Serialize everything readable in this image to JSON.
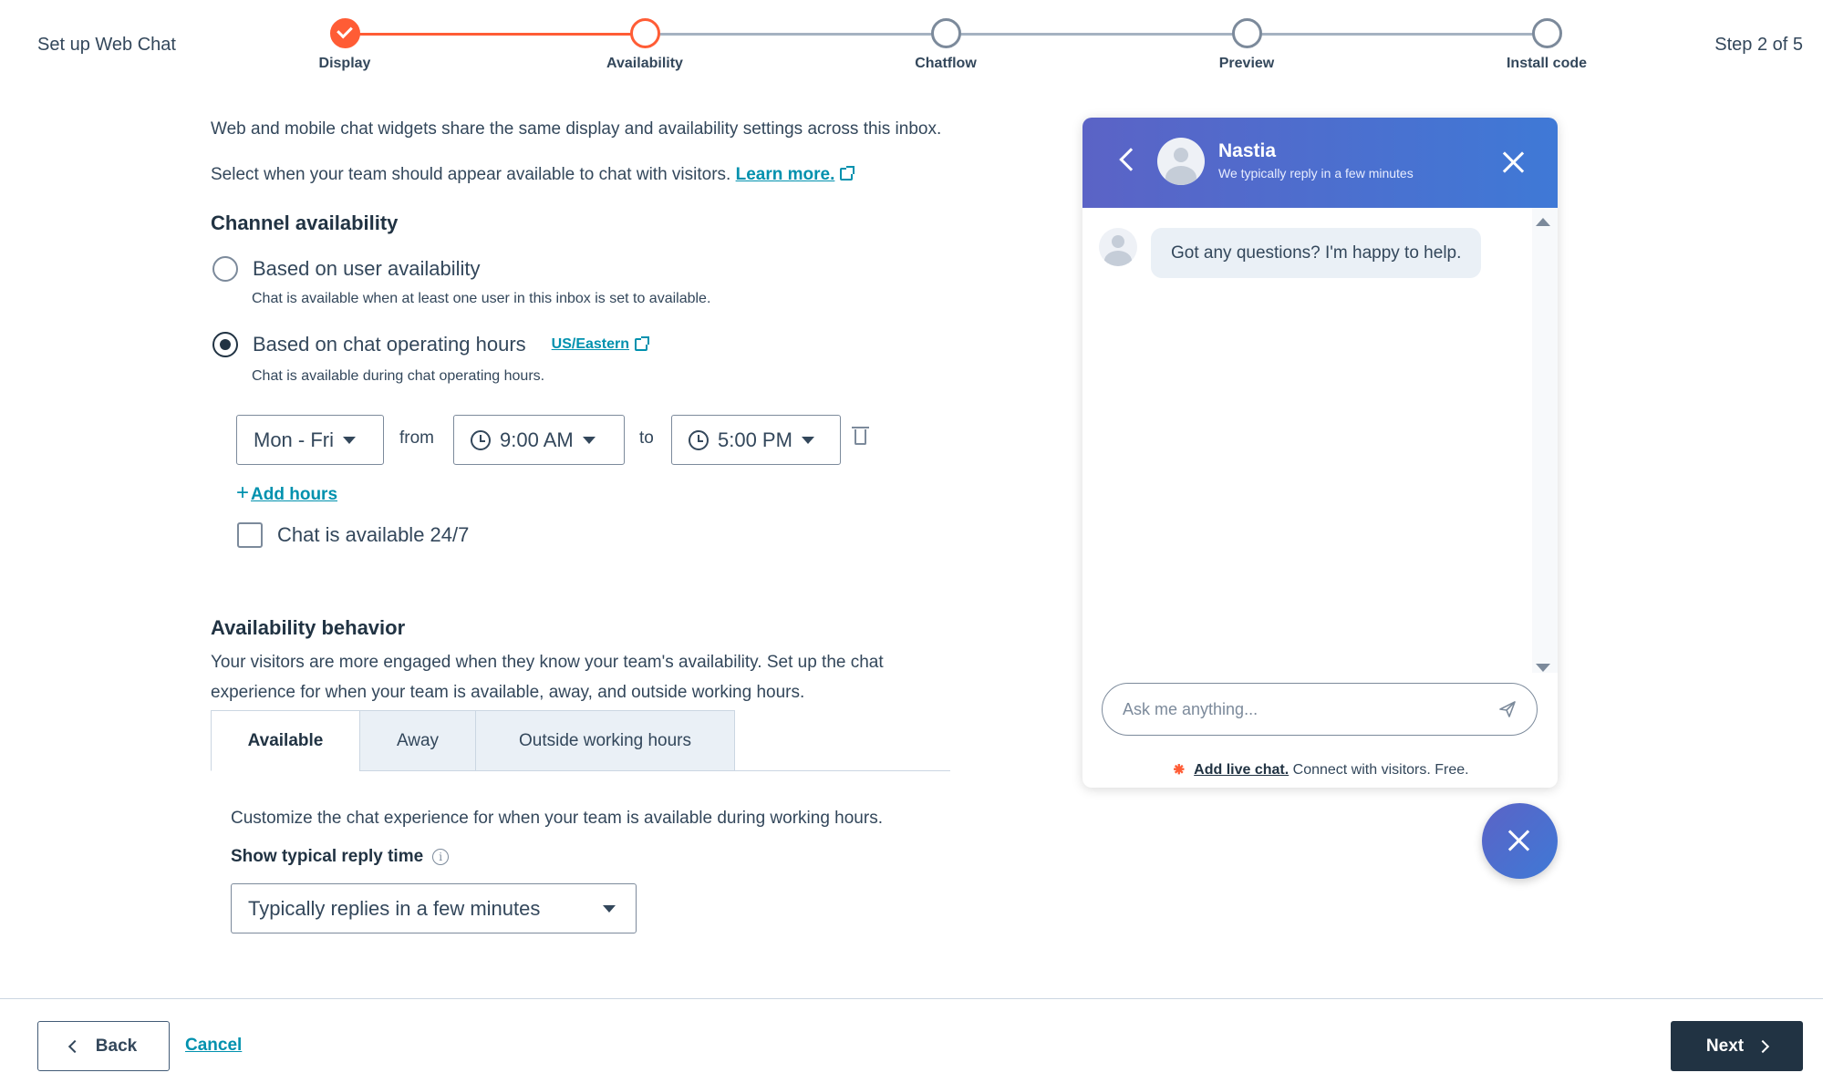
{
  "header": {
    "title": "Set up Web Chat",
    "step_count": "Step 2 of 5",
    "steps": [
      {
        "label": "Display",
        "state": "complete"
      },
      {
        "label": "Availability",
        "state": "active"
      },
      {
        "label": "Chatflow",
        "state": "pending"
      },
      {
        "label": "Preview",
        "state": "pending"
      },
      {
        "label": "Install code",
        "state": "pending"
      }
    ]
  },
  "intro": {
    "shared_settings_text": "Web and mobile chat widgets share the same display and availability settings across this inbox.",
    "select_text": "Select when your team should appear available to chat with visitors.",
    "learn_more": "Learn more."
  },
  "channel_availability": {
    "title": "Channel availability",
    "options": [
      {
        "label": "Based on user availability",
        "help": "Chat is available when at least one user in this inbox is set to available.",
        "selected": false
      },
      {
        "label": "Based on chat operating hours",
        "help": "Chat is available during chat operating hours.",
        "selected": true
      }
    ],
    "timezone_link": "US/Eastern",
    "hours": {
      "days": "Mon - Fri",
      "from_label": "from",
      "start": "9:00 AM",
      "to_label": "to",
      "end": "5:00 PM"
    },
    "add_hours": "Add hours",
    "always_available_label": "Chat is available 24/7",
    "always_available_checked": false
  },
  "availability_behavior": {
    "title": "Availability behavior",
    "description": "Your visitors are more engaged when they know your team's availability. Set up the chat experience for when your team is available, away, and outside working hours.",
    "tabs": [
      {
        "label": "Available",
        "active": true
      },
      {
        "label": "Away",
        "active": false
      },
      {
        "label": "Outside working hours",
        "active": false
      }
    ],
    "tab_description": "Customize the chat experience for when your team is available during working hours.",
    "reply_time_label": "Show typical reply time",
    "reply_time_value": "Typically replies in a few minutes"
  },
  "chat_preview": {
    "agent_name": "Nastia",
    "reply_subtitle": "We typically reply in a few minutes",
    "greeting": "Got any questions? I'm happy to help.",
    "input_placeholder": "Ask me anything...",
    "footer_link": "Add live chat.",
    "footer_text": "Connect with visitors. Free.",
    "header_gradient": [
      "#5b63c6",
      "#3f79d6"
    ]
  },
  "footer": {
    "back_label": "Back",
    "cancel_label": "Cancel",
    "next_label": "Next"
  },
  "colors": {
    "accent": "#ff5c35",
    "link": "#0091ae",
    "primary_dark": "#213343",
    "text": "#33475b"
  }
}
